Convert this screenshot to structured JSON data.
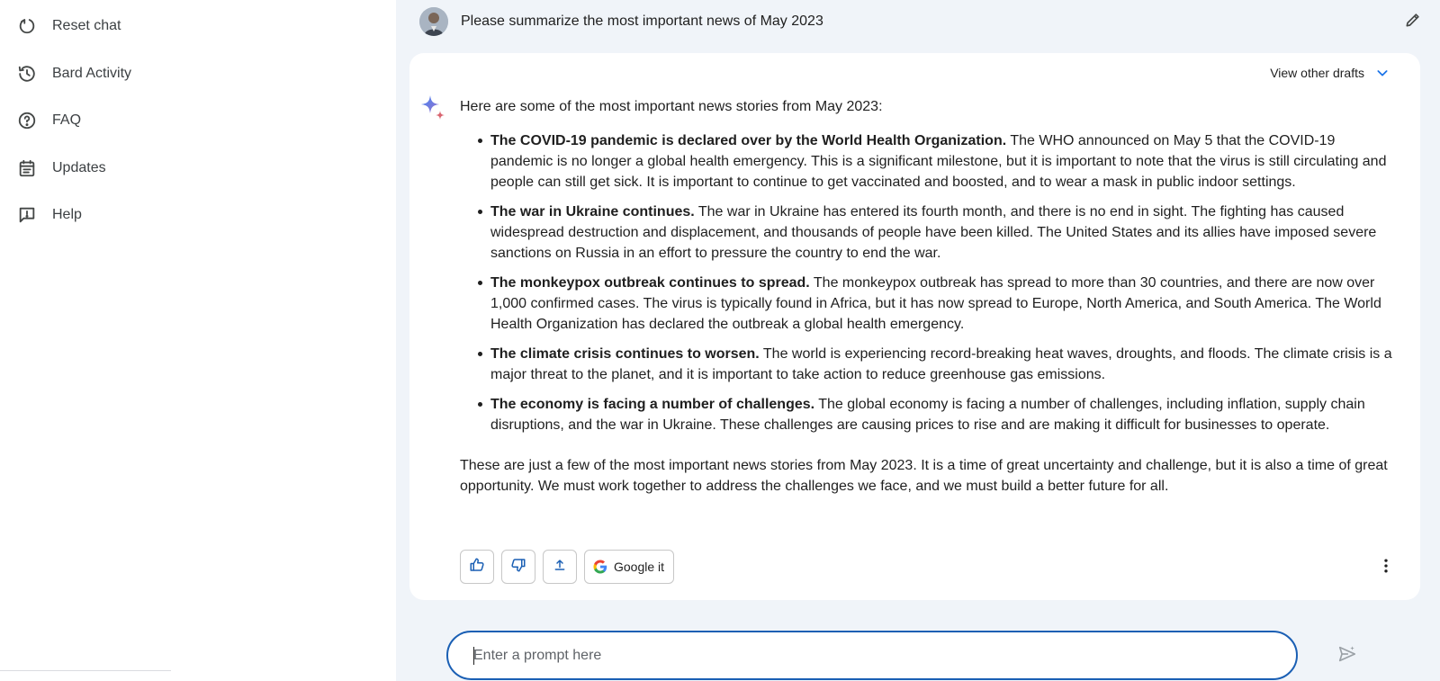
{
  "sidebar": {
    "items": [
      {
        "label": "Reset chat",
        "icon": "reset-icon"
      },
      {
        "label": "Bard Activity",
        "icon": "history-icon"
      },
      {
        "label": "FAQ",
        "icon": "help-circle-icon"
      },
      {
        "label": "Updates",
        "icon": "calendar-icon"
      },
      {
        "label": "Help",
        "icon": "feedback-icon"
      }
    ]
  },
  "conversation": {
    "user_prompt": "Please summarize the most important news of May 2023",
    "view_drafts_label": "View other drafts",
    "response": {
      "intro": "Here are some of the most important news stories from May 2023:",
      "items": [
        {
          "bold": "The COVID-19 pandemic is declared over by the World Health Organization.",
          "text": " The WHO announced on May 5 that the COVID-19 pandemic is no longer a global health emergency. This is a significant milestone, but it is important to note that the virus is still circulating and people can still get sick. It is important to continue to get vaccinated and boosted, and to wear a mask in public indoor settings."
        },
        {
          "bold": "The war in Ukraine continues.",
          "text": " The war in Ukraine has entered its fourth month, and there is no end in sight. The fighting has caused widespread destruction and displacement, and thousands of people have been killed. The United States and its allies have imposed severe sanctions on Russia in an effort to pressure the country to end the war."
        },
        {
          "bold": "The monkeypox outbreak continues to spread.",
          "text": " The monkeypox outbreak has spread to more than 30 countries, and there are now over 1,000 confirmed cases. The virus is typically found in Africa, but it has now spread to Europe, North America, and South America. The World Health Organization has declared the outbreak a global health emergency."
        },
        {
          "bold": "The climate crisis continues to worsen.",
          "text": " The world is experiencing record-breaking heat waves, droughts, and floods. The climate crisis is a major threat to the planet, and it is important to take action to reduce greenhouse gas emissions."
        },
        {
          "bold": "The economy is facing a number of challenges.",
          "text": " The global economy is facing a number of challenges, including inflation, supply chain disruptions, and the war in Ukraine. These challenges are causing prices to rise and are making it difficult for businesses to operate."
        }
      ],
      "outro": "These are just a few of the most important news stories from May 2023. It is a time of great uncertainty and challenge, but it is also a time of great opportunity. We must work together to address the challenges we face, and we must build a better future for all."
    },
    "actions": {
      "google_it_label": "Google it"
    }
  },
  "prompt_input": {
    "placeholder": "Enter a prompt here"
  },
  "colors": {
    "main_background": "#f0f4f9",
    "input_border": "#1a5fb4",
    "drafts_chevron": "#1a73e8"
  }
}
